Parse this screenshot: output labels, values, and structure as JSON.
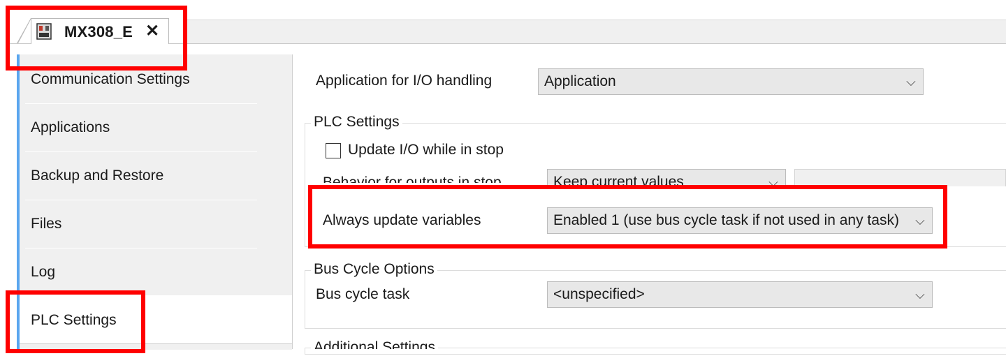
{
  "tab": {
    "title": "MX308_E",
    "close_icon": "close-icon",
    "device_icon": "plc-device-icon"
  },
  "sidebar": {
    "items": [
      {
        "label": "Communication Settings",
        "selected": false
      },
      {
        "label": "Applications",
        "selected": false
      },
      {
        "label": "Backup and Restore",
        "selected": false
      },
      {
        "label": "Files",
        "selected": false
      },
      {
        "label": "Log",
        "selected": false
      },
      {
        "label": "PLC Settings",
        "selected": true
      }
    ]
  },
  "main": {
    "io_handling": {
      "label": "Application for I/O handling",
      "value": "Application"
    },
    "plc_settings": {
      "title": "PLC Settings",
      "update_io": {
        "label": "Update I/O while in stop",
        "checked": false
      },
      "behavior": {
        "label": "Behavior for outputs in stop",
        "value": "Keep current values"
      },
      "always_update": {
        "label": "Always update variables",
        "value": "Enabled 1 (use bus cycle task if not used in any task)"
      }
    },
    "bus_cycle": {
      "title": "Bus Cycle Options",
      "task": {
        "label": "Bus cycle task",
        "value": "<unspecified>"
      }
    },
    "additional": {
      "title": "Additional Settings"
    }
  },
  "colors": {
    "accent": "#5aa6ef",
    "annotation": "#ff0000",
    "panel": "#f0f0f0"
  }
}
